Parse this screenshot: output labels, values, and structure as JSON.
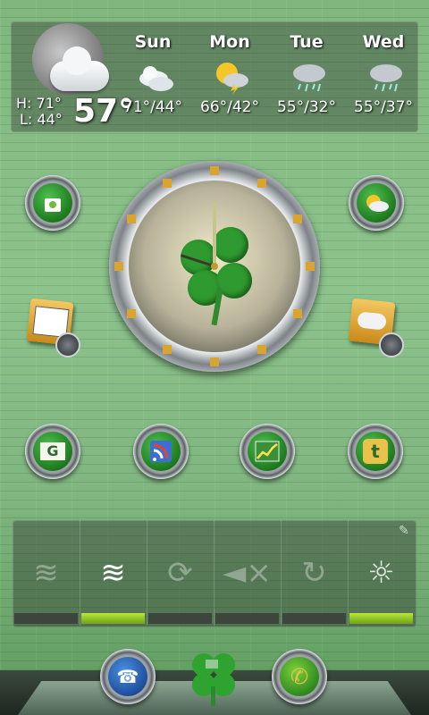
{
  "weather": {
    "high": "H: 71°",
    "low": "L: 44°",
    "current": "57°",
    "days": [
      {
        "name": "Sun",
        "temps": "71°/44°",
        "icon": "cloudy-icon"
      },
      {
        "name": "Mon",
        "temps": "66°/42°",
        "icon": "thunderstorm-sun-icon"
      },
      {
        "name": "Tue",
        "temps": "55°/32°",
        "icon": "rain-icon"
      },
      {
        "name": "Wed",
        "temps": "55°/37°",
        "icon": "rain-icon"
      }
    ]
  },
  "home_icons": {
    "market": "shopping-bag-icon",
    "weather_app": "sun-cloud-icon",
    "folder_left": "folder-icon",
    "folder_right": "gamepad-folder-icon",
    "gmail": "gmail-envelope-icon",
    "rss": "rss-feed-icon",
    "finance": "chart-icon",
    "twitter": "twitter-icon",
    "twitter_letter": "t",
    "gmail_letter": "G"
  },
  "toggles": [
    {
      "name": "wifi",
      "on": false
    },
    {
      "name": "wifi-alarm",
      "on": true
    },
    {
      "name": "sync",
      "on": false
    },
    {
      "name": "sound-mute",
      "on": false
    },
    {
      "name": "rotate",
      "on": false
    },
    {
      "name": "auto-brightness",
      "on": true
    }
  ],
  "dock": {
    "contacts": "phone-book-icon",
    "launcher": "clover-icon",
    "phone": "phone-icon"
  },
  "colors": {
    "accent_green": "#8dd12b",
    "background_green": "#7fb77f"
  }
}
